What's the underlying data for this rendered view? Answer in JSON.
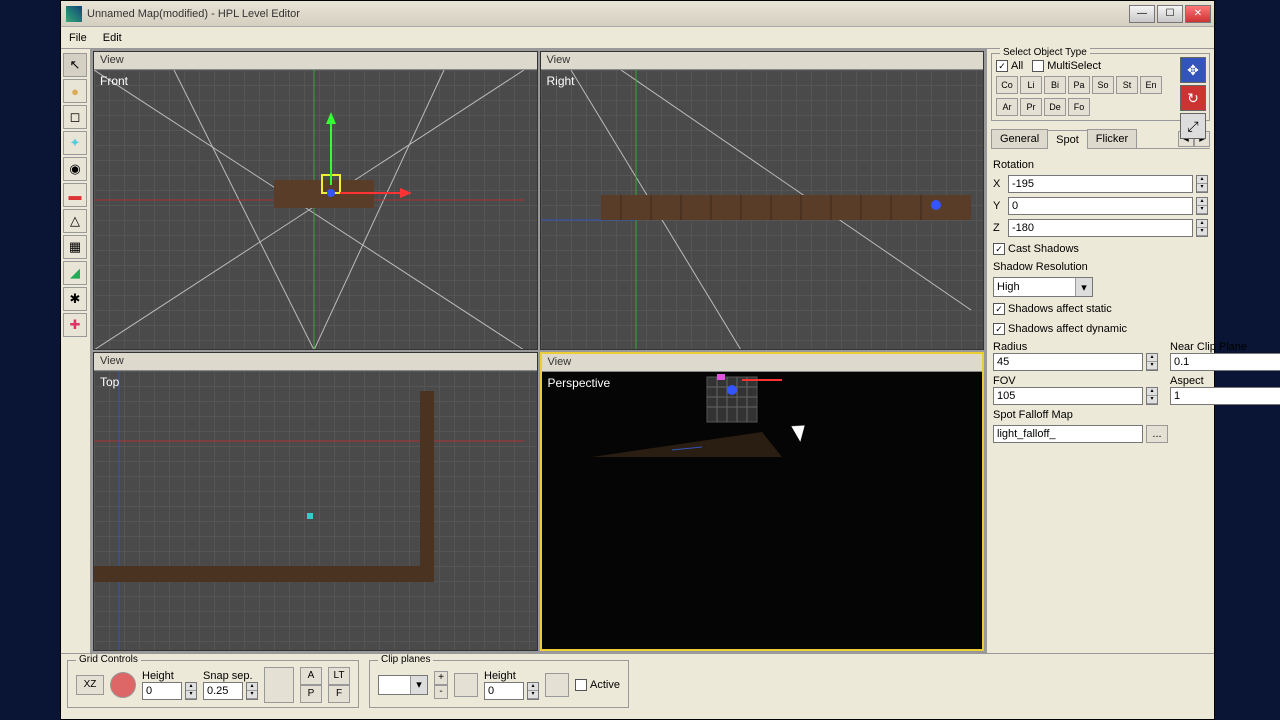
{
  "window": {
    "title": "Unnamed Map(modified) - HPL Level Editor"
  },
  "menu": {
    "file": "File",
    "edit": "Edit"
  },
  "viewports": {
    "header": "View",
    "front": "Front",
    "right": "Right",
    "top": "Top",
    "perspective": "Perspective"
  },
  "selectObjectType": {
    "title": "Select Object Type",
    "all": "All",
    "multi": "MultiSelect",
    "row1": [
      "Co",
      "Li",
      "Bi",
      "Pa",
      "So",
      "St",
      "En"
    ],
    "row2": [
      "Ar",
      "Pr",
      "De",
      "Fo"
    ]
  },
  "tabs": {
    "general": "General",
    "spot": "Spot",
    "flicker": "Flicker"
  },
  "spot": {
    "rotation_label": "Rotation",
    "x": "-195",
    "y": "0",
    "z": "-180",
    "castShadows": "Cast Shadows",
    "shadowRes_label": "Shadow Resolution",
    "shadowRes": "High",
    "affectStatic": "Shadows affect static",
    "affectDynamic": "Shadows affect dynamic",
    "radius_label": "Radius",
    "radius": "45",
    "nearClip_label": "Near Clip Plane",
    "nearClip": "0.1",
    "fov_label": "FOV",
    "fov": "105",
    "aspect_label": "Aspect",
    "aspect": "1",
    "falloff_label": "Spot Falloff Map",
    "falloff": "light_falloff_",
    "browse": "..."
  },
  "grid": {
    "title": "Grid Controls",
    "plane": "XZ",
    "height_label": "Height",
    "height": "0",
    "snap_label": "Snap sep.",
    "snap": "0.25",
    "A": "A",
    "LT": "LT",
    "P": "P",
    "F": "F"
  },
  "clip": {
    "title": "Clip planes",
    "plus": "+",
    "minus": "-",
    "height_label": "Height",
    "height": "0",
    "active": "Active"
  }
}
